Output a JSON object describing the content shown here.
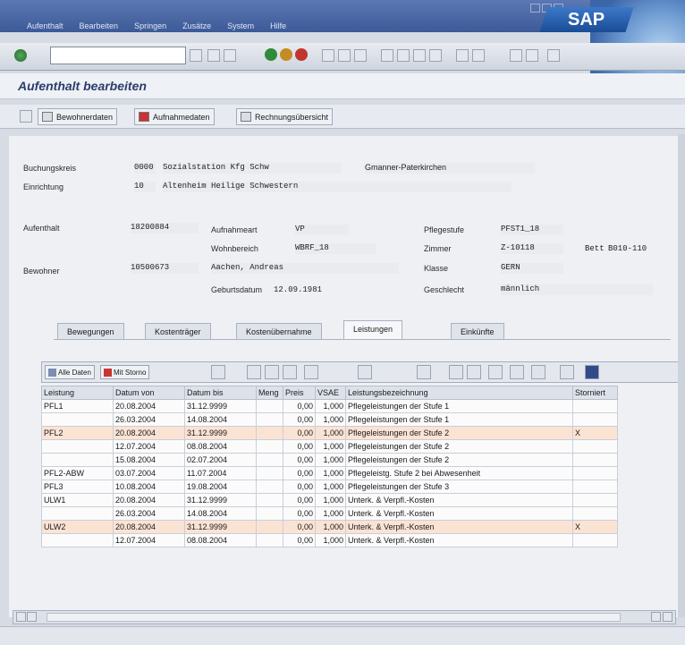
{
  "menu": [
    "Aufenthalt",
    "Bearbeiten",
    "Springen",
    "Zusätze",
    "System",
    "Hilfe"
  ],
  "brand": "SAP",
  "page_title": "Aufenthalt bearbeiten",
  "app_toolbar": {
    "bewohnerdaten": "Bewohnerdaten",
    "aufnahmedaten": "Aufnahmedaten",
    "rechnungsuebersicht": "Rechnungsübersicht"
  },
  "header": {
    "buchungskreis_label": "Buchungskreis",
    "buchungskreis_code": "0000",
    "buchungskreis_name": "Sozialstation Kfg Schw",
    "buchungskreis_ort": "Gmanner-Paterkirchen",
    "einrichtung_label": "Einrichtung",
    "einrichtung_code": "10",
    "einrichtung_name": "Altenheim Heilige Schwestern",
    "aufenthalt_label": "Aufenthalt",
    "aufenthalt_value": "18200884",
    "aufnahmeart_label": "Aufnahmeart",
    "aufnahmeart_value": "VP",
    "wohnbereich_label": "Wohnbereich",
    "wohnbereich_value": "WBRF_18",
    "pflegestufe_label": "Pflegestufe",
    "pflegestufe_value": "PFST1_18",
    "zimmer_label": "Zimmer",
    "zimmer_value": "Z-10118",
    "bett_label": "Bett",
    "bett_value": "B010-110",
    "bewohner_label": "Bewohner",
    "bewohner_id": "10500673",
    "bewohner_name": "Aachen, Andreas",
    "klasse_label": "Klasse",
    "klasse_value": "GERN",
    "geburtsdatum_label": "Geburtsdatum",
    "geburtsdatum_value": "12.09.1981",
    "geschlecht_label": "Geschlecht",
    "geschlecht_value": "männlich"
  },
  "tabs": [
    "Bewegungen",
    "Kostenträger",
    "Kostenübernahme",
    "Leistungen",
    "Einkünfte"
  ],
  "grid_toolbar": {
    "alle_daten": "Alle Daten",
    "mit_storno": "Mit Storno"
  },
  "table": {
    "columns": [
      "Leistung",
      "Datum von",
      "Datum bis",
      "Meng",
      "Preis",
      "VSAE",
      "Leistungsbezeichnung",
      "Storniert"
    ],
    "rows": [
      {
        "leistung": "PFL1",
        "von": "20.08.2004",
        "bis": "31.12.9999",
        "meng": "",
        "preis": "0,00",
        "vsae": "1,000",
        "bez": "Pflegeleistungen der Stufe 1",
        "storno": "",
        "hl": false
      },
      {
        "leistung": "",
        "von": "26.03.2004",
        "bis": "14.08.2004",
        "meng": "",
        "preis": "0,00",
        "vsae": "1,000",
        "bez": "Pflegeleistungen der Stufe 1",
        "storno": "",
        "hl": false
      },
      {
        "leistung": "PFL2",
        "von": "20.08.2004",
        "bis": "31.12.9999",
        "meng": "",
        "preis": "0,00",
        "vsae": "1,000",
        "bez": "Pflegeleistungen der Stufe 2",
        "storno": "X",
        "hl": true
      },
      {
        "leistung": "",
        "von": "12.07.2004",
        "bis": "08.08.2004",
        "meng": "",
        "preis": "0,00",
        "vsae": "1,000",
        "bez": "Pflegeleistungen der Stufe 2",
        "storno": "",
        "hl": false
      },
      {
        "leistung": "",
        "von": "15.08.2004",
        "bis": "02.07.2004",
        "meng": "",
        "preis": "0,00",
        "vsae": "1,000",
        "bez": "Pflegeleistungen der Stufe 2",
        "storno": "",
        "hl": false
      },
      {
        "leistung": "PFL2-ABW",
        "von": "03.07.2004",
        "bis": "11.07.2004",
        "meng": "",
        "preis": "0,00",
        "vsae": "1,000",
        "bez": "Pflegeleistg. Stufe 2 bei Abwesenheit",
        "storno": "",
        "hl": false
      },
      {
        "leistung": "PFL3",
        "von": "10.08.2004",
        "bis": "19.08.2004",
        "meng": "",
        "preis": "0,00",
        "vsae": "1,000",
        "bez": "Pflegeleistungen der Stufe 3",
        "storno": "",
        "hl": false
      },
      {
        "leistung": "ULW1",
        "von": "20.08.2004",
        "bis": "31.12.9999",
        "meng": "",
        "preis": "0,00",
        "vsae": "1,000",
        "bez": "Unterk. & Verpfl.-Kosten",
        "storno": "",
        "hl": false
      },
      {
        "leistung": "",
        "von": "26.03.2004",
        "bis": "14.08.2004",
        "meng": "",
        "preis": "0,00",
        "vsae": "1,000",
        "bez": "Unterk. & Verpfl.-Kosten",
        "storno": "",
        "hl": false
      },
      {
        "leistung": "ULW2",
        "von": "20.08.2004",
        "bis": "31.12.9999",
        "meng": "",
        "preis": "0,00",
        "vsae": "1,000",
        "bez": "Unterk. & Verpfl.-Kosten",
        "storno": "X",
        "hl": true
      },
      {
        "leistung": "",
        "von": "12.07.2004",
        "bis": "08.08.2004",
        "meng": "",
        "preis": "0,00",
        "vsae": "1,000",
        "bez": "Unterk. & Verpfl.-Kosten",
        "storno": "",
        "hl": false
      }
    ]
  },
  "colors": {
    "title_bar": "#3d5a98",
    "row_highlight": "#fbe3d4",
    "page_title": "#2b3e6c"
  }
}
